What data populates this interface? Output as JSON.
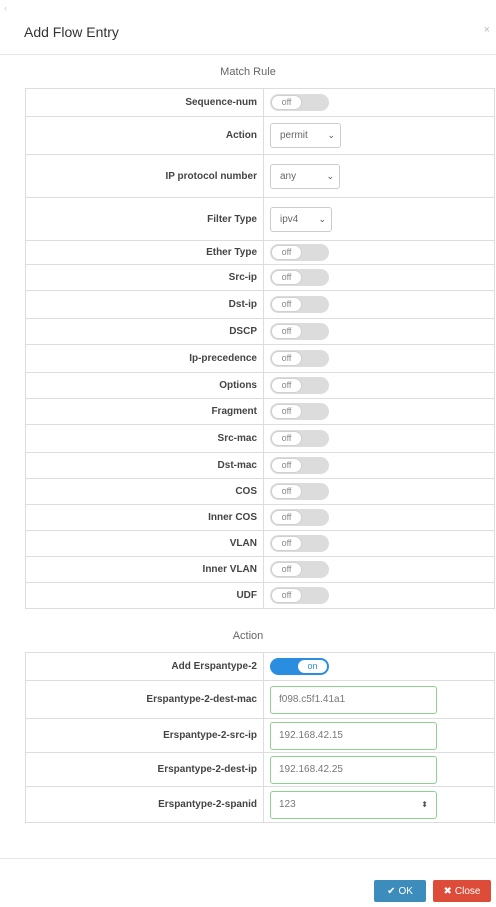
{
  "dialog": {
    "title": "Add Flow Entry",
    "close_glyph": "×",
    "corner_glyph": "‹"
  },
  "match": {
    "heading": "Match Rule",
    "rows": [
      {
        "label": "Sequence-num",
        "type": "toggle",
        "state": "off"
      },
      {
        "label": "Action",
        "type": "select",
        "value": "permit"
      },
      {
        "label": "IP protocol number",
        "type": "select",
        "value": "any"
      },
      {
        "label": "Filter Type",
        "type": "select",
        "value": "ipv4"
      },
      {
        "label": "Ether Type",
        "type": "toggle",
        "state": "off"
      },
      {
        "label": "Src-ip",
        "type": "toggle",
        "state": "off"
      },
      {
        "label": "Dst-ip",
        "type": "toggle",
        "state": "off"
      },
      {
        "label": "DSCP",
        "type": "toggle",
        "state": "off"
      },
      {
        "label": "Ip-precedence",
        "type": "toggle",
        "state": "off"
      },
      {
        "label": "Options",
        "type": "toggle",
        "state": "off"
      },
      {
        "label": "Fragment",
        "type": "toggle",
        "state": "off"
      },
      {
        "label": "Src-mac",
        "type": "toggle",
        "state": "off"
      },
      {
        "label": "Dst-mac",
        "type": "toggle",
        "state": "off"
      },
      {
        "label": "COS",
        "type": "toggle",
        "state": "off"
      },
      {
        "label": "Inner COS",
        "type": "toggle",
        "state": "off"
      },
      {
        "label": "VLAN",
        "type": "toggle",
        "state": "off"
      },
      {
        "label": "Inner VLAN",
        "type": "toggle",
        "state": "off"
      },
      {
        "label": "UDF",
        "type": "toggle",
        "state": "off"
      }
    ]
  },
  "action": {
    "heading": "Action",
    "rows": [
      {
        "label": "Add Erspantype-2",
        "type": "toggle",
        "state": "on"
      },
      {
        "label": "Erspantype-2-dest-mac",
        "type": "input",
        "value": "f098.c5f1.41a1"
      },
      {
        "label": "Erspantype-2-src-ip",
        "type": "input",
        "value": "192.168.42.15"
      },
      {
        "label": "Erspantype-2-dest-ip",
        "type": "input",
        "value": "192.168.42.25"
      },
      {
        "label": "Erspantype-2-spanid",
        "type": "stepper",
        "value": "123"
      }
    ]
  },
  "footer": {
    "ok_label": "OK",
    "close_label": "Close",
    "ok_icon": "check-icon",
    "close_icon": "x-icon"
  },
  "colors": {
    "ok": "#3c8dbc",
    "close": "#dd4b39",
    "toggle_on": "#2b8de0",
    "input_border": "#8fd08f"
  }
}
